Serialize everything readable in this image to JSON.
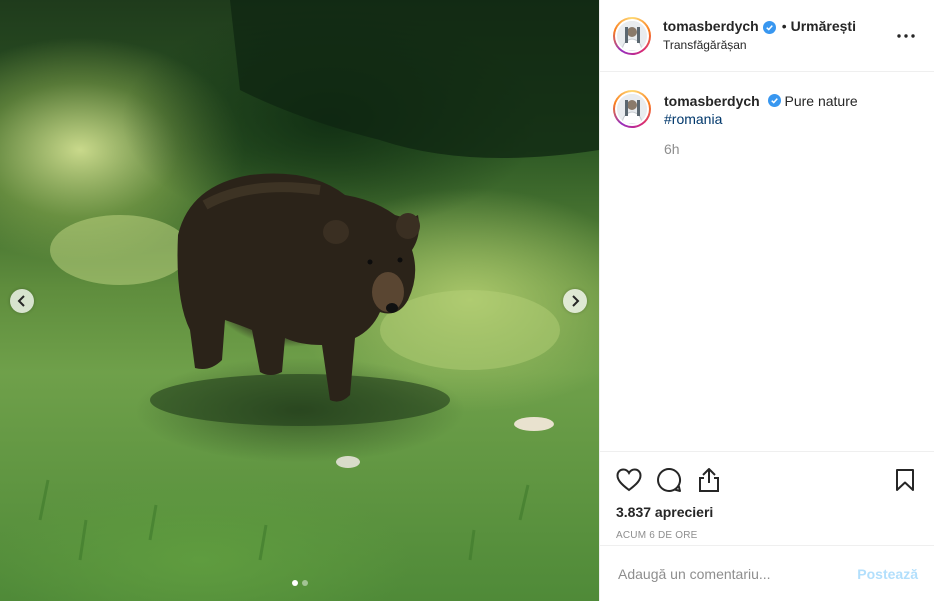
{
  "post": {
    "username": "tomasberdych",
    "follow_status": "Urmărești",
    "separator": "•",
    "location": "Transfăgărășan",
    "caption_text": "Pure nature",
    "hashtag": "#romania",
    "caption_time": "6h",
    "likes": "3.837 aprecieri",
    "age": "ACUM 6 DE ORE"
  },
  "comment_box": {
    "placeholder": "Adaugă un comentariu...",
    "post_label": "Postează"
  },
  "carousel": {
    "slides": 2,
    "active": 1
  },
  "icons": {
    "verified": "verified-badge-icon",
    "more": "more-options-icon",
    "like": "heart-icon",
    "comment": "comment-icon",
    "share": "share-icon",
    "save": "bookmark-icon",
    "prev": "chevron-left-icon",
    "next": "chevron-right-icon"
  },
  "colors": {
    "verified": "#3897f0",
    "hashtag": "#00376b",
    "muted": "#8e8e8e",
    "post_button_disabled": "#b2dffc"
  }
}
